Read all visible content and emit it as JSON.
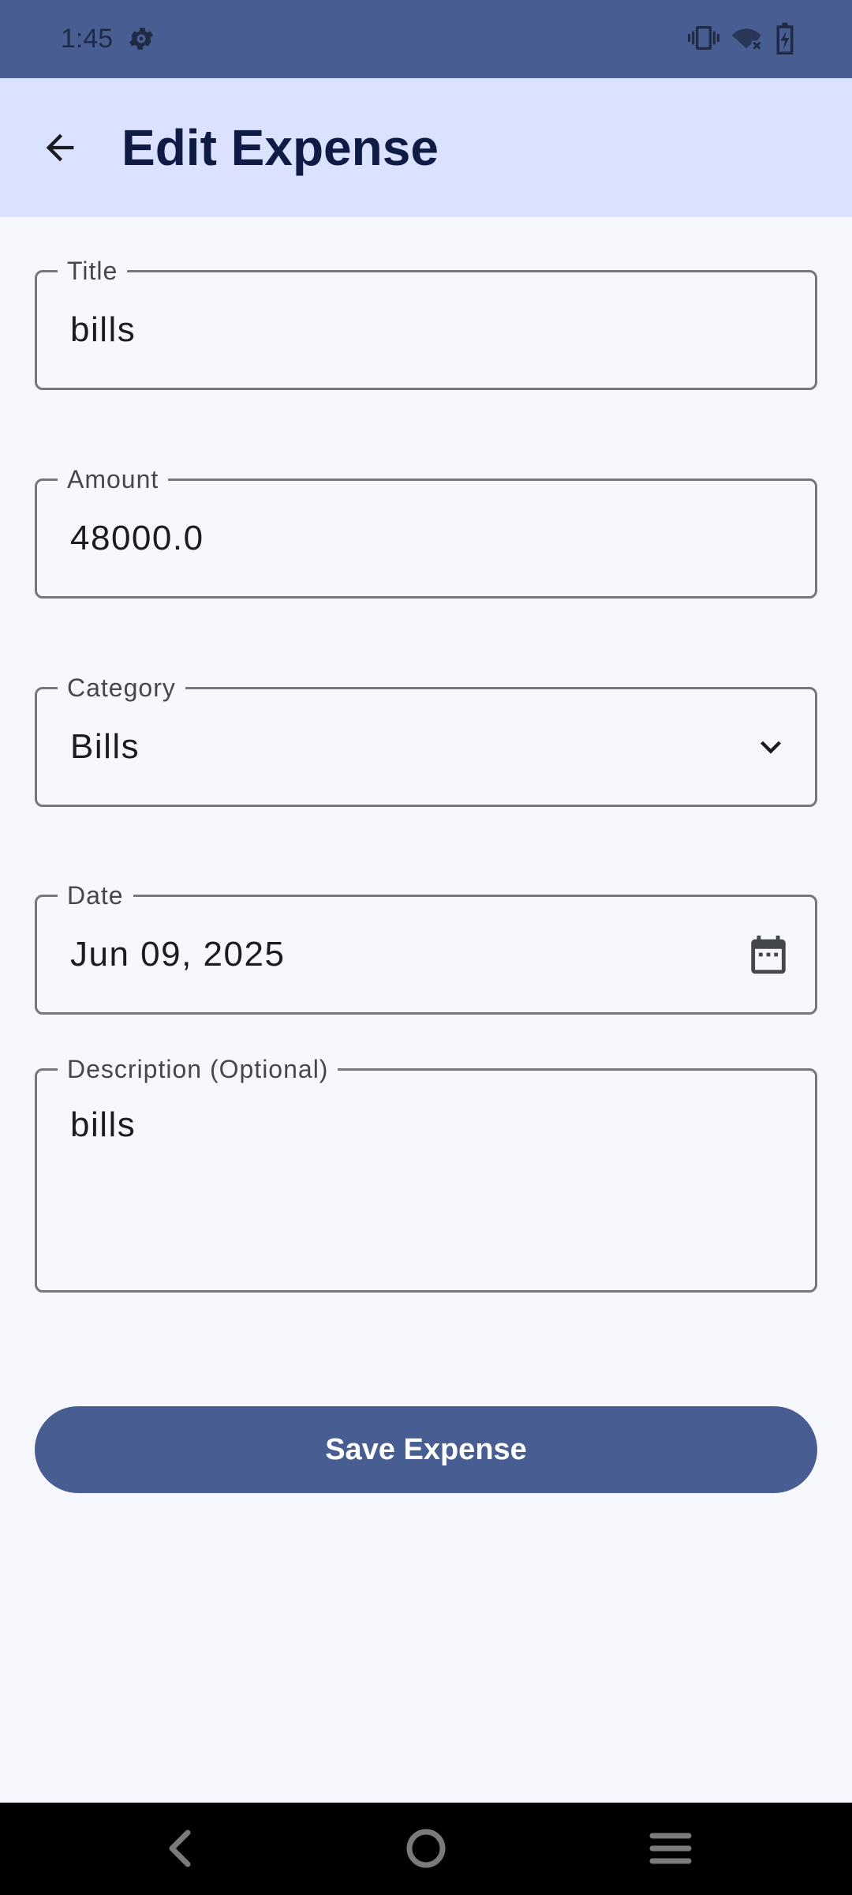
{
  "status_bar": {
    "time": "1:45",
    "icons": [
      "settings-icon",
      "vibrate-icon",
      "wifi-off-icon",
      "battery-charging-icon"
    ]
  },
  "app_bar": {
    "title": "Edit Expense",
    "back_icon": "arrow-back-icon"
  },
  "form": {
    "title": {
      "label": "Title",
      "value": "bills"
    },
    "amount": {
      "label": "Amount",
      "value": "48000.0"
    },
    "category": {
      "label": "Category",
      "value": "Bills",
      "trailing_icon": "chevron-down-icon"
    },
    "date": {
      "label": "Date",
      "value": "Jun 09, 2025",
      "trailing_icon": "calendar-icon"
    },
    "description": {
      "label": "Description (Optional)",
      "value": "bills"
    }
  },
  "save_button": {
    "label": "Save Expense"
  },
  "nav_bar": {
    "icons": [
      "nav-back-icon",
      "nav-home-icon",
      "nav-recents-icon"
    ]
  },
  "colors": {
    "primary": "#485d91",
    "app_bar_bg": "#dae2ff",
    "background": "#f7f8fe",
    "outline": "#74777f"
  }
}
